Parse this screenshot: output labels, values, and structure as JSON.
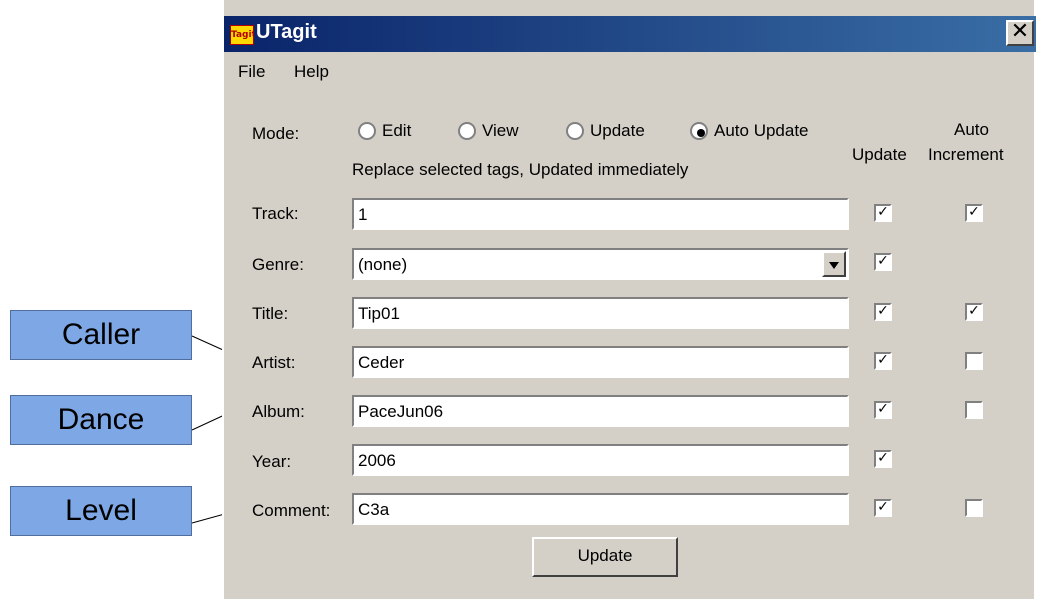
{
  "window": {
    "title": "UTagit",
    "icon_text": "Tagit",
    "close_label": "✕"
  },
  "menu": {
    "file": "File",
    "help": "Help"
  },
  "mode": {
    "label": "Mode:",
    "options": [
      "Edit",
      "View",
      "Update",
      "Auto Update"
    ],
    "selected": "Auto Update",
    "description": "Replace selected tags, Updated immediately"
  },
  "headers": {
    "update": "Update",
    "auto_line1": "Auto",
    "auto_line2": "Increment"
  },
  "fields": {
    "track": {
      "label": "Track:",
      "value": "1",
      "update": true,
      "auto": true
    },
    "genre": {
      "label": "Genre:",
      "value": "(none)",
      "update": true
    },
    "title": {
      "label": "Title:",
      "value": "Tip01",
      "update": true,
      "auto": true
    },
    "artist": {
      "label": "Artist:",
      "value": "Ceder",
      "update": true,
      "auto": false
    },
    "album": {
      "label": "Album:",
      "value": "PaceJun06",
      "update": true,
      "auto": false
    },
    "year": {
      "label": "Year:",
      "value": "2006",
      "update": true
    },
    "comment": {
      "label": "Comment:",
      "value": "C3a",
      "update": true,
      "auto": false
    }
  },
  "update_button": "Update",
  "callouts": {
    "caller": "Caller",
    "dance": "Dance",
    "level": "Level"
  }
}
